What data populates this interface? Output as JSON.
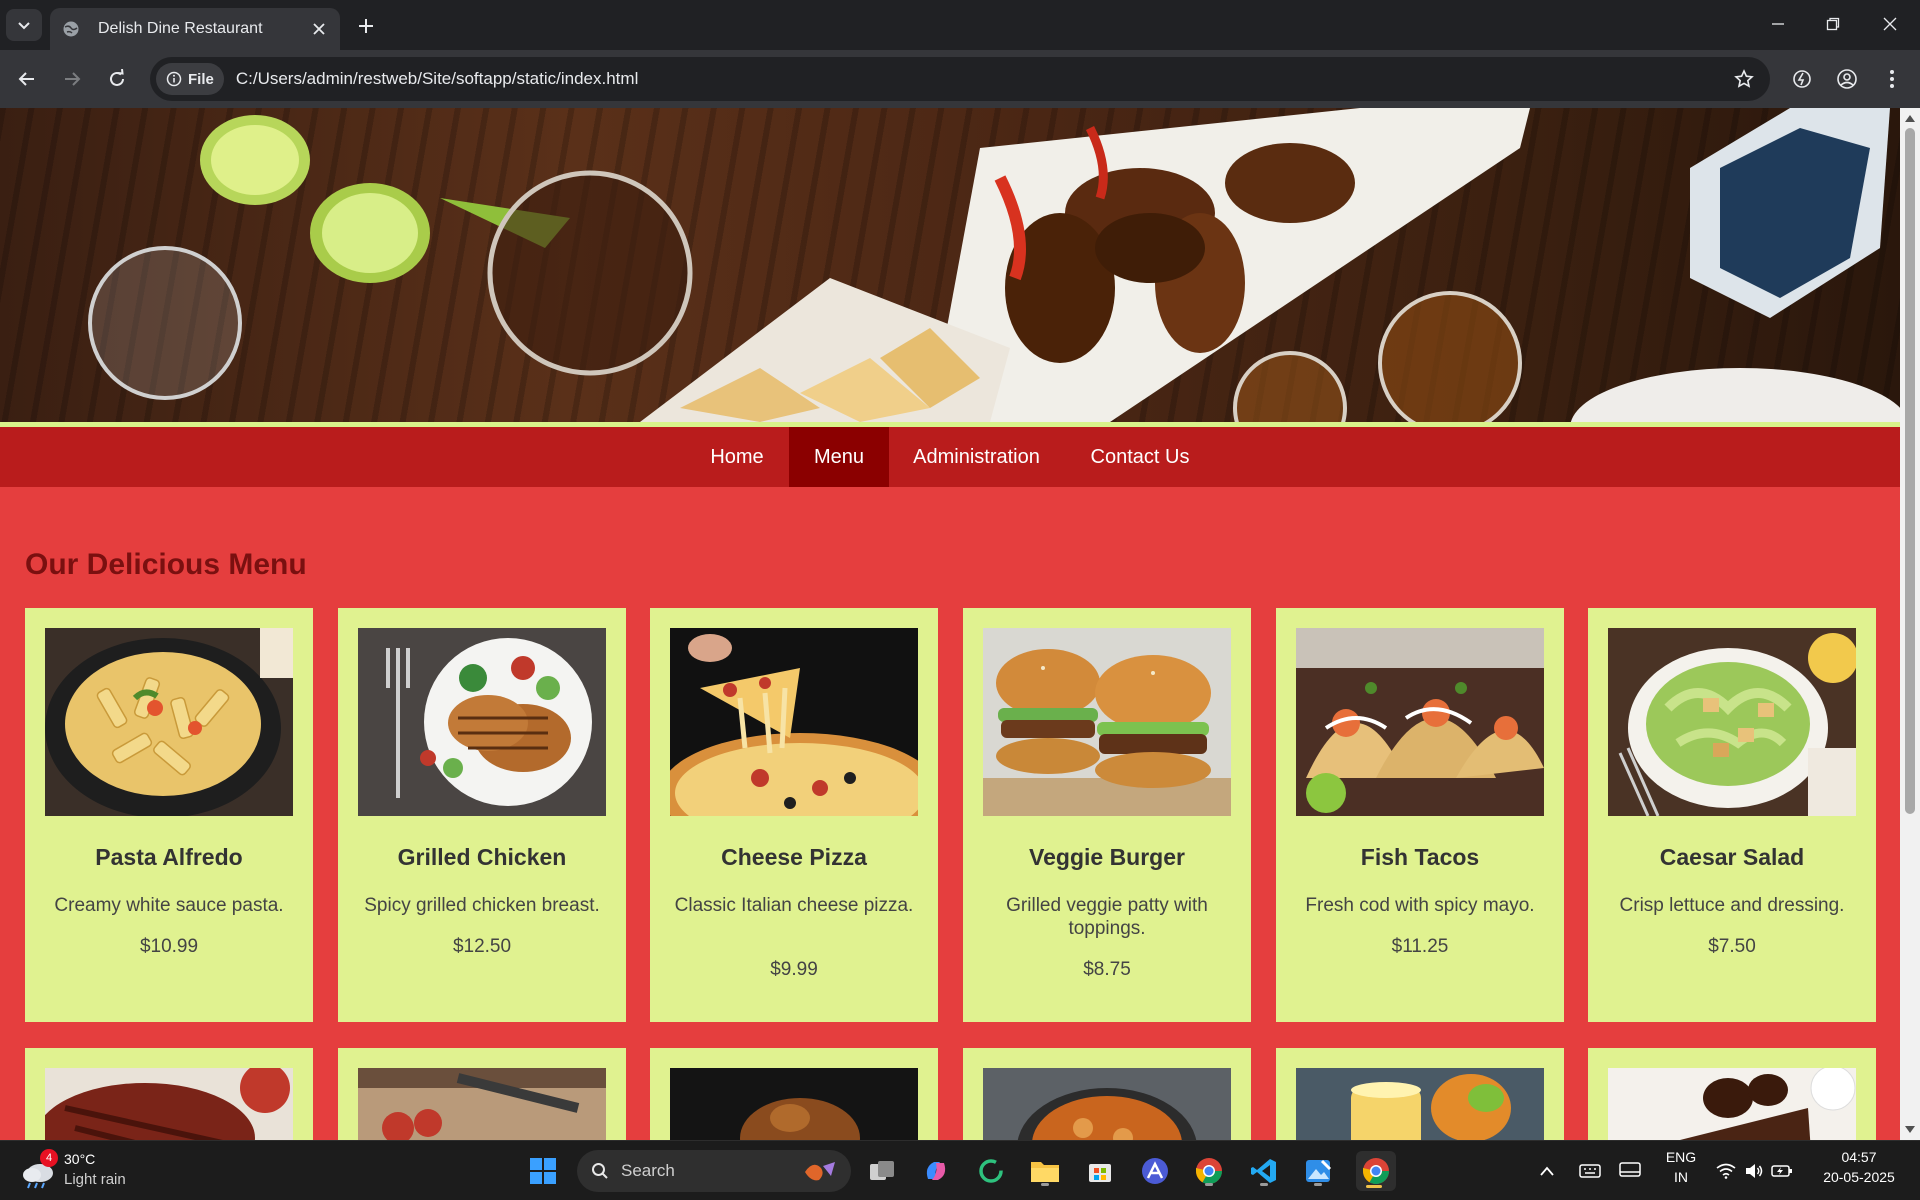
{
  "browser": {
    "tab_title": "Delish Dine Restaurant",
    "omnibox_chip": "File",
    "url": "C:/Users/admin/restweb/Site/softapp/static/index.html"
  },
  "nav": {
    "items": [
      {
        "label": "Home",
        "active": false
      },
      {
        "label": "Menu",
        "active": true
      },
      {
        "label": "Administration",
        "active": false
      },
      {
        "label": "Contact Us",
        "active": false
      }
    ]
  },
  "menu": {
    "heading": "Our Delicious Menu",
    "items": [
      {
        "name": "Pasta Alfredo",
        "description": "Creamy white sauce pasta.",
        "price": "$10.99"
      },
      {
        "name": "Grilled Chicken",
        "description": "Spicy grilled chicken breast.",
        "price": "$12.50"
      },
      {
        "name": "Cheese Pizza",
        "description": "Classic Italian cheese pizza.",
        "price": "$9.99"
      },
      {
        "name": "Veggie Burger",
        "description": "Grilled veggie patty with toppings.",
        "price": "$8.75"
      },
      {
        "name": "Fish Tacos",
        "description": "Fresh cod with spicy mayo.",
        "price": "$11.25"
      },
      {
        "name": "Caesar Salad",
        "description": "Crisp lettuce and dressing.",
        "price": "$7.50"
      }
    ]
  },
  "taskbar": {
    "weather_temp": "30°C",
    "weather_desc": "Light rain",
    "weather_badge": "4",
    "search_label": "Search",
    "lang_top": "ENG",
    "lang_bottom": "IN",
    "time": "04:57",
    "date": "20-05-2025"
  },
  "colors": {
    "page_bg": "#e53e3e",
    "navbar": "#b91c1c",
    "nav_active": "#8b0000",
    "card_bg": "#e0f290",
    "heading": "#7a1010"
  }
}
